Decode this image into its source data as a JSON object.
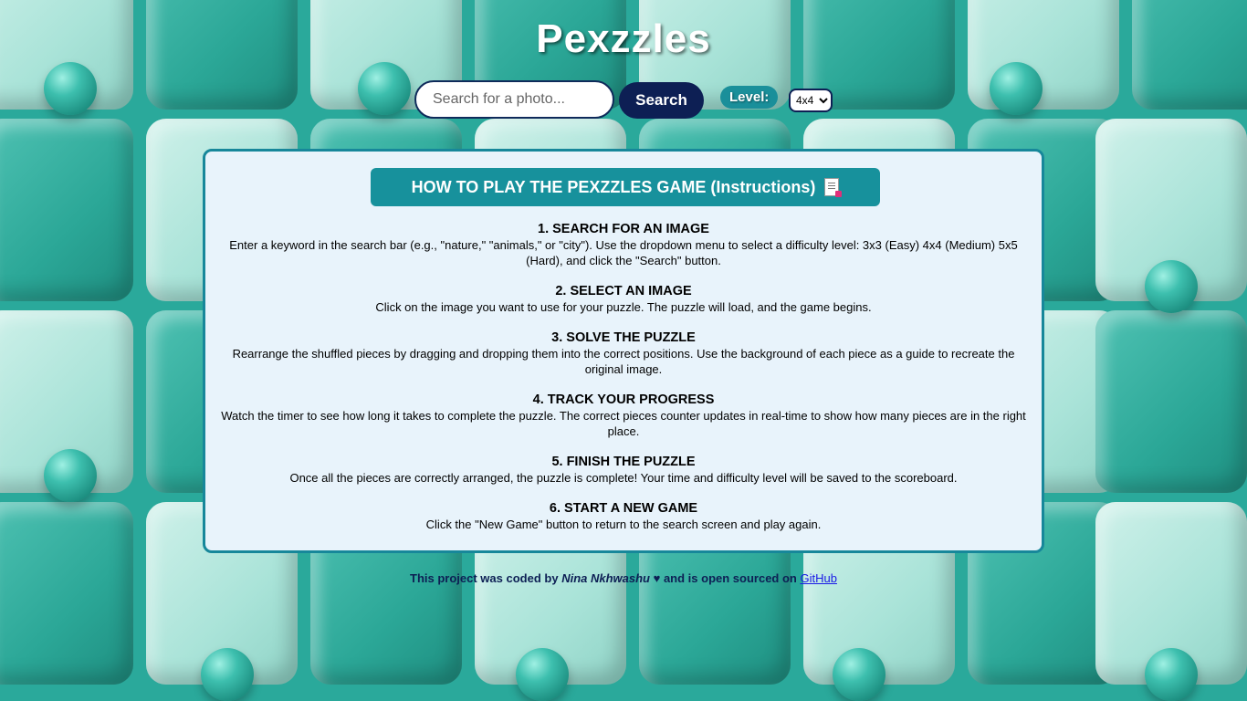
{
  "app": {
    "title": "Pexzzles"
  },
  "search": {
    "placeholder": "Search for a photo...",
    "value": "",
    "button_label": "Search"
  },
  "level": {
    "label": "Level:",
    "selected": "4x4"
  },
  "instructions": {
    "heading": "HOW TO PLAY THE PEXZZLES GAME (Instructions)",
    "heading_icon": "document-icon",
    "steps": [
      {
        "title": "1. SEARCH FOR AN IMAGE",
        "text": "Enter a keyword in the search bar (e.g., \"nature,\" \"animals,\" or \"city\"). Use the dropdown menu to select a difficulty level: 3x3 (Easy) 4x4 (Medium) 5x5 (Hard), and click the \"Search\" button."
      },
      {
        "title": "2. SELECT AN IMAGE",
        "text": "Click on the image you want to use for your puzzle. The puzzle will load, and the game begins."
      },
      {
        "title": "3. SOLVE THE PUZZLE",
        "text": "Rearrange the shuffled pieces by dragging and dropping them into the correct positions. Use the background of each piece as a guide to recreate the original image."
      },
      {
        "title": "4. TRACK YOUR PROGRESS",
        "text": "Watch the timer to see how long it takes to complete the puzzle. The correct pieces counter updates in real-time to show how many pieces are in the right place."
      },
      {
        "title": "5. FINISH THE PUZZLE",
        "text": "Once all the pieces are correctly arranged, the puzzle is complete! Your time and difficulty level will be saved to the scoreboard."
      },
      {
        "title": "6. START A NEW GAME",
        "text": "Click the \"New Game\" button to return to the search screen and play again."
      }
    ]
  },
  "footer": {
    "prefix": "This project was coded by",
    "author": "Nina Nkhwashu",
    "heart": "♥",
    "middle": "and is open sourced on",
    "link_label": "GitHub"
  },
  "colors": {
    "accent": "#17919c",
    "navy": "#0d1f54",
    "panel_bg": "#e8f3fb"
  }
}
